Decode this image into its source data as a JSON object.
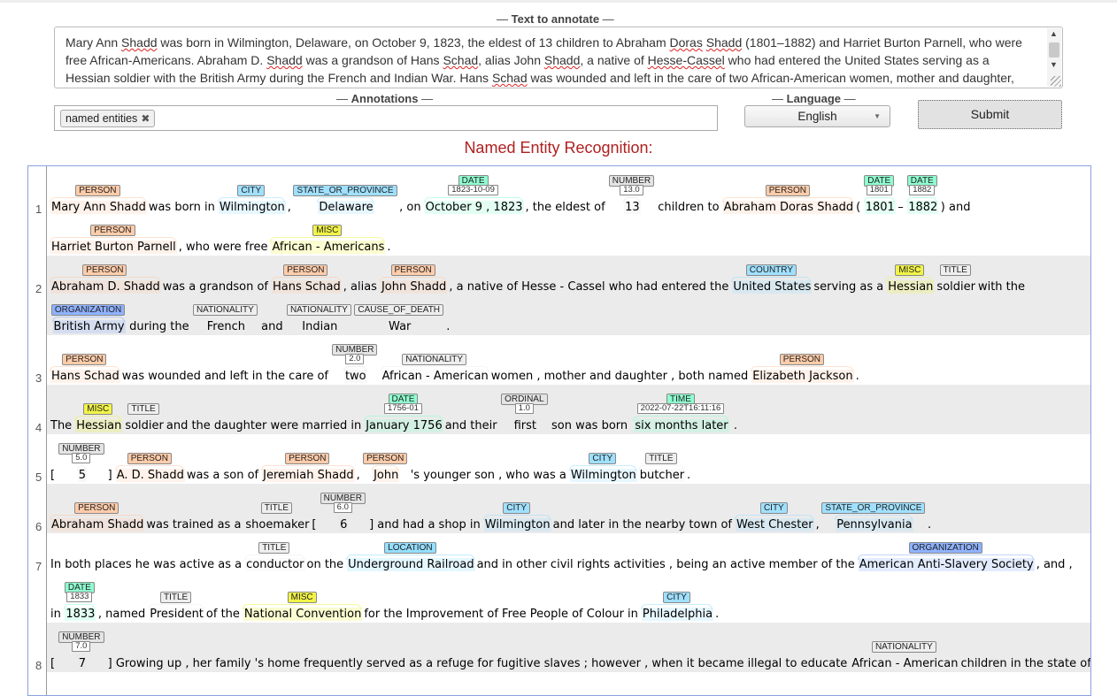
{
  "form": {
    "text_legend": "Text to annotate",
    "textarea_lines": [
      [
        [
          "Mary Ann ",
          0
        ],
        [
          "Shadd",
          1
        ],
        [
          " was born in Wilmington, Delaware, on October 9, 1823, the eldest of 13 children to Abraham ",
          0
        ],
        [
          "Doras",
          1
        ],
        [
          " ",
          0
        ],
        [
          "Shadd",
          1
        ],
        [
          " (1801–1882) and Harriet Burton Parnell, who were",
          0
        ]
      ],
      [
        [
          "free African-Americans. Abraham D. ",
          0
        ],
        [
          "Shadd",
          1
        ],
        [
          " was a grandson of Hans ",
          0
        ],
        [
          "Schad",
          1
        ],
        [
          ", alias John ",
          0
        ],
        [
          "Shadd",
          1
        ],
        [
          ", a native of ",
          0
        ],
        [
          "Hesse-Cassel",
          1
        ],
        [
          " who had entered the United States serving as a",
          0
        ]
      ],
      [
        [
          "Hessian soldier with the British Army during the French and Indian War. Hans ",
          0
        ],
        [
          "Schad",
          1
        ],
        [
          " was wounded and left in the care of two African-American women, mother and daughter,",
          0
        ]
      ]
    ],
    "annotations_legend": "Annotations",
    "annotation_tag": "named entities",
    "annotation_tag_remove": "✖",
    "language_legend": "Language",
    "language_value": "English",
    "submit_label": "Submit"
  },
  "result_title": "Named Entity Recognition:",
  "colors": {
    "PERSON": "#ffccaa",
    "CITY": "#a0e0ff",
    "STATE_OR_PROVINCE": "#a0e0ff",
    "COUNTRY": "#a0e0ff",
    "DATE": "#8fffd0",
    "TIME": "#8fffd0",
    "NUMBER": "#e4e4e4",
    "ORDINAL": "#e4e4e4",
    "MISC": "#f1f447",
    "TITLE": "#eeeeee",
    "NATIONALITY": "#eeeeee",
    "CAUSE_OF_DEATH": "#eeeeee",
    "ORGANIZATION": "#8fb2ff",
    "LOCATION": "#95dfff"
  },
  "sentences": [
    {
      "n": "1",
      "rows": [
        [
          [
            "Mary Ann Shadd",
            "PERSON"
          ],
          [
            "was born in"
          ],
          [
            "Wilmington",
            "CITY"
          ],
          [
            ","
          ],
          [
            "Delaware",
            "STATE_OR_PROVINCE"
          ],
          [
            ", on"
          ],
          [
            "October 9 , 1823",
            "DATE",
            "1823-10-09"
          ],
          [
            ", the eldest of"
          ],
          [
            "13",
            "NUMBER",
            "13.0"
          ],
          [
            "children to"
          ],
          [
            "Abraham Doras Shadd",
            "PERSON"
          ],
          [
            "("
          ],
          [
            "1801",
            "DATE",
            "1801"
          ],
          [
            "–"
          ],
          [
            "1882",
            "DATE",
            "1882"
          ],
          [
            ") and"
          ]
        ],
        [
          [
            "Harriet Burton Parnell",
            "PERSON"
          ],
          [
            ", who were free"
          ],
          [
            "African - Americans",
            "MISC"
          ],
          [
            "."
          ]
        ]
      ]
    },
    {
      "n": "2",
      "rows": [
        [
          [
            "Abraham D. Shadd",
            "PERSON"
          ],
          [
            "was a grandson of"
          ],
          [
            "Hans Schad",
            "PERSON"
          ],
          [
            ", alias"
          ],
          [
            "John Shadd",
            "PERSON"
          ],
          [
            ", a native of Hesse - Cassel who had entered the"
          ],
          [
            "United States",
            "COUNTRY"
          ],
          [
            "serving as a"
          ],
          [
            "Hessian",
            "MISC"
          ],
          [
            "soldier",
            "TITLE"
          ],
          [
            "with the"
          ]
        ],
        [
          [
            "British Army",
            "ORGANIZATION"
          ],
          [
            "during the"
          ],
          [
            "French",
            "NATIONALITY"
          ],
          [
            "and"
          ],
          [
            "Indian",
            "NATIONALITY"
          ],
          [
            "War",
            "CAUSE_OF_DEATH"
          ],
          [
            "."
          ]
        ]
      ]
    },
    {
      "n": "3",
      "rows": [
        [
          [
            "Hans Schad",
            "PERSON"
          ],
          [
            "was wounded and left in the care of"
          ],
          [
            "two",
            "NUMBER",
            "2.0"
          ],
          [
            "African - American",
            "NATIONALITY"
          ],
          [
            "women , mother and daughter , both named"
          ],
          [
            "Elizabeth Jackson",
            "PERSON"
          ],
          [
            "."
          ]
        ]
      ]
    },
    {
      "n": "4",
      "rows": [
        [
          [
            "The"
          ],
          [
            "Hessian",
            "MISC"
          ],
          [
            "soldier",
            "TITLE"
          ],
          [
            "and the daughter were married in"
          ],
          [
            "January 1756",
            "DATE",
            "1756-01"
          ],
          [
            "and their"
          ],
          [
            "first",
            "ORDINAL",
            "1.0"
          ],
          [
            "son was born"
          ],
          [
            "six months later",
            "TIME",
            "2022-07-22T16:11:16"
          ],
          [
            "."
          ]
        ]
      ]
    },
    {
      "n": "5",
      "rows": [
        [
          [
            "["
          ],
          [
            "5",
            "NUMBER",
            "5.0"
          ],
          [
            "]"
          ],
          [
            "A. D. Shadd",
            "PERSON"
          ],
          [
            "was a son of"
          ],
          [
            "Jeremiah Shadd",
            "PERSON"
          ],
          [
            ","
          ],
          [
            "John",
            "PERSON"
          ],
          [
            "'s younger son , who was a"
          ],
          [
            "Wilmington",
            "CITY"
          ],
          [
            "butcher",
            "TITLE"
          ],
          [
            "."
          ]
        ]
      ]
    },
    {
      "n": "6",
      "rows": [
        [
          [
            "Abraham Shadd",
            "PERSON"
          ],
          [
            "was trained as a"
          ],
          [
            "shoemaker",
            "TITLE"
          ],
          [
            "["
          ],
          [
            "6",
            "NUMBER",
            "6.0"
          ],
          [
            "] and had a shop in"
          ],
          [
            "Wilmington",
            "CITY"
          ],
          [
            "and later in the nearby town of"
          ],
          [
            "West Chester",
            "CITY"
          ],
          [
            ","
          ],
          [
            "Pennsylvania",
            "STATE_OR_PROVINCE"
          ],
          [
            "."
          ]
        ]
      ]
    },
    {
      "n": "7",
      "rows": [
        [
          [
            "In both places he was active as a"
          ],
          [
            "conductor",
            "TITLE"
          ],
          [
            "on the"
          ],
          [
            "Underground Railroad",
            "LOCATION"
          ],
          [
            "and in other civil rights activities , being an active member of the"
          ],
          [
            "American Anti-Slavery Society",
            "ORGANIZATION"
          ],
          [
            ", and ,"
          ]
        ],
        [
          [
            "in"
          ],
          [
            "1833",
            "DATE",
            "1833"
          ],
          [
            ", named"
          ],
          [
            "President",
            "TITLE"
          ],
          [
            "of the"
          ],
          [
            "National Convention",
            "MISC"
          ],
          [
            "for the Improvement of Free People of Colour in"
          ],
          [
            "Philadelphia",
            "CITY"
          ],
          [
            "."
          ]
        ]
      ]
    },
    {
      "n": "8",
      "rows": [
        [
          [
            "["
          ],
          [
            "7",
            "NUMBER",
            "7.0"
          ],
          [
            "] Growing up , her family 's home frequently served as a refuge for fugitive slaves ; however , when it became illegal to educate"
          ],
          [
            "African - American",
            "NATIONALITY"
          ],
          [
            "children in the state of"
          ]
        ]
      ]
    }
  ]
}
